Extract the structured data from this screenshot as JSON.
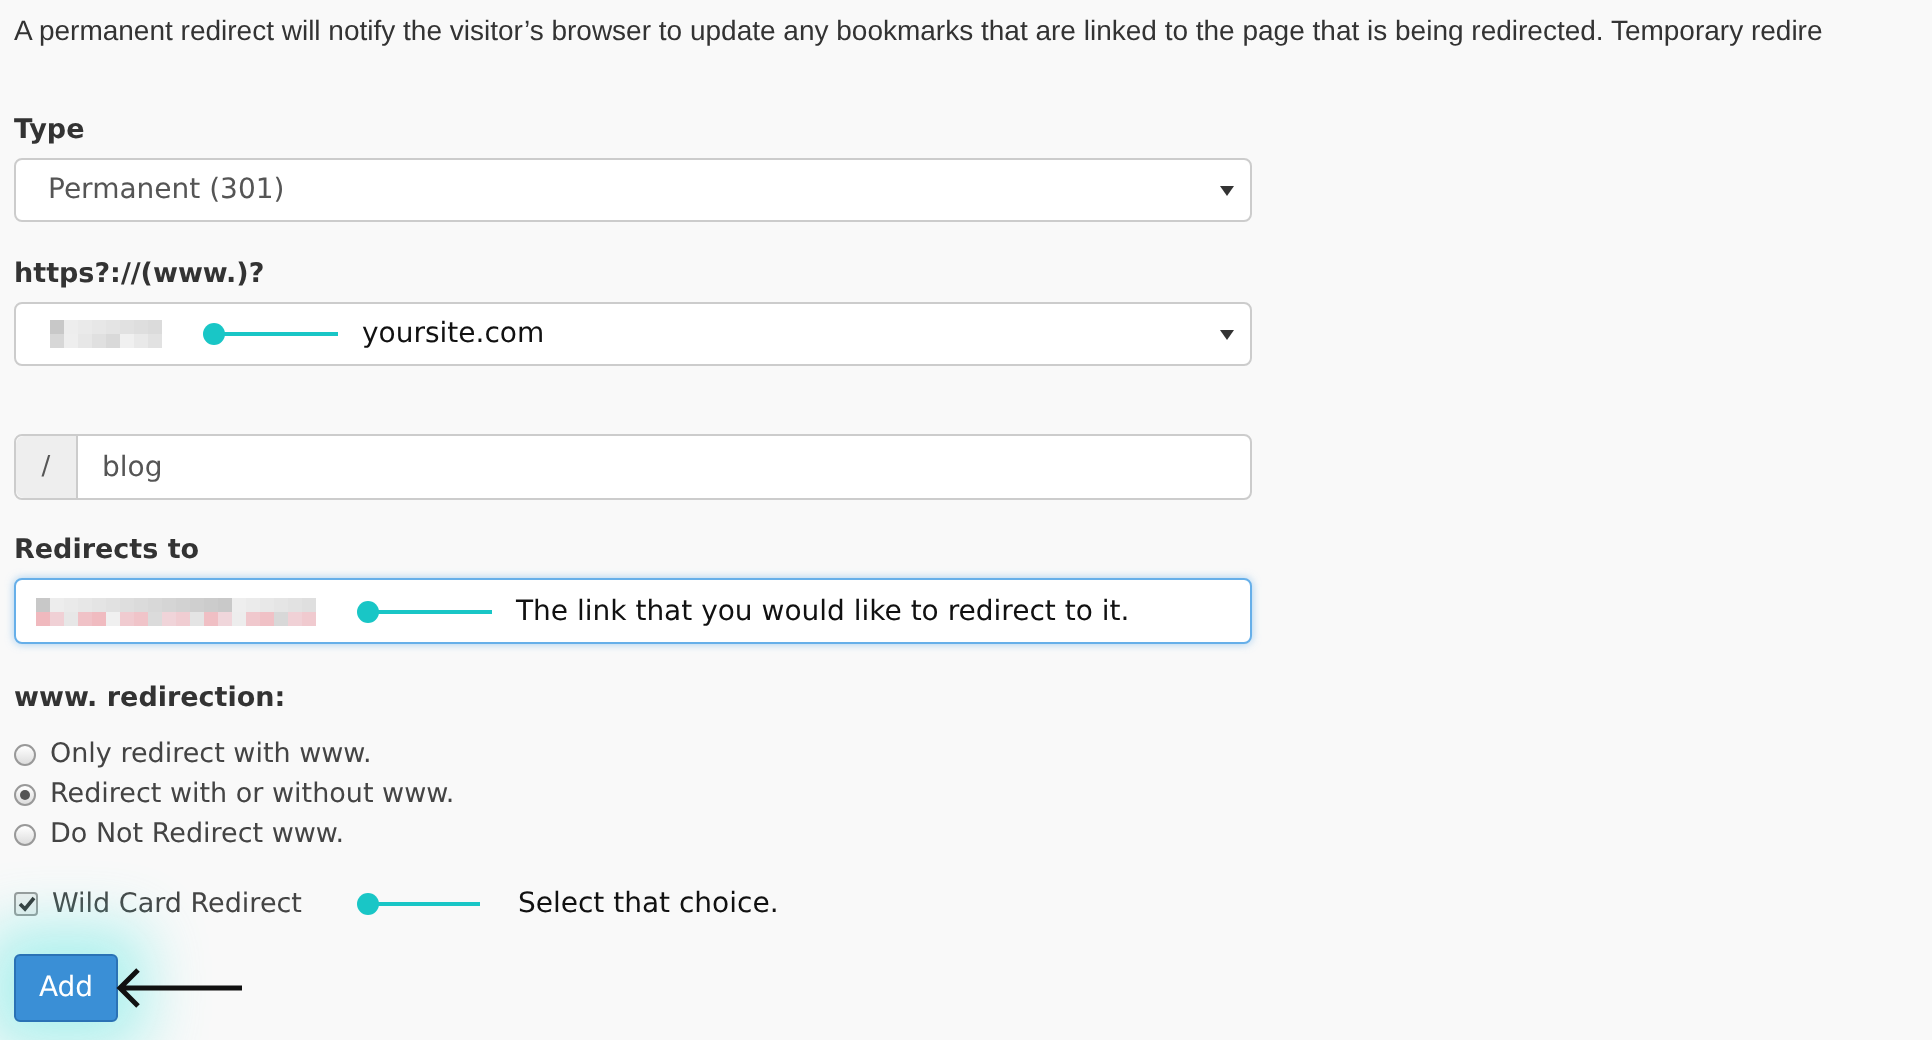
{
  "intro": "A permanent redirect will notify the visitor’s browser to update any bookmarks that are linked to the page that is being redirected. Temporary redire",
  "type_field": {
    "label": "Type",
    "value": "Permanent (301)"
  },
  "domain_field": {
    "label": "https?://(www.)?",
    "annotation": "yoursite.com"
  },
  "path_field": {
    "prefix": "/",
    "value": "blog"
  },
  "redirect_field": {
    "label": "Redirects to",
    "focused": true,
    "annotation": "The link that you would like to redirect to it."
  },
  "www_redirection": {
    "label": "www. redirection:",
    "options": [
      {
        "label": "Only redirect with www.",
        "selected": false
      },
      {
        "label": "Redirect with or without www.",
        "selected": true
      },
      {
        "label": "Do Not Redirect www.",
        "selected": false
      }
    ]
  },
  "wildcard": {
    "label": "Wild Card Redirect",
    "checked": true,
    "annotation": "Select that choice."
  },
  "add_button": "Add"
}
